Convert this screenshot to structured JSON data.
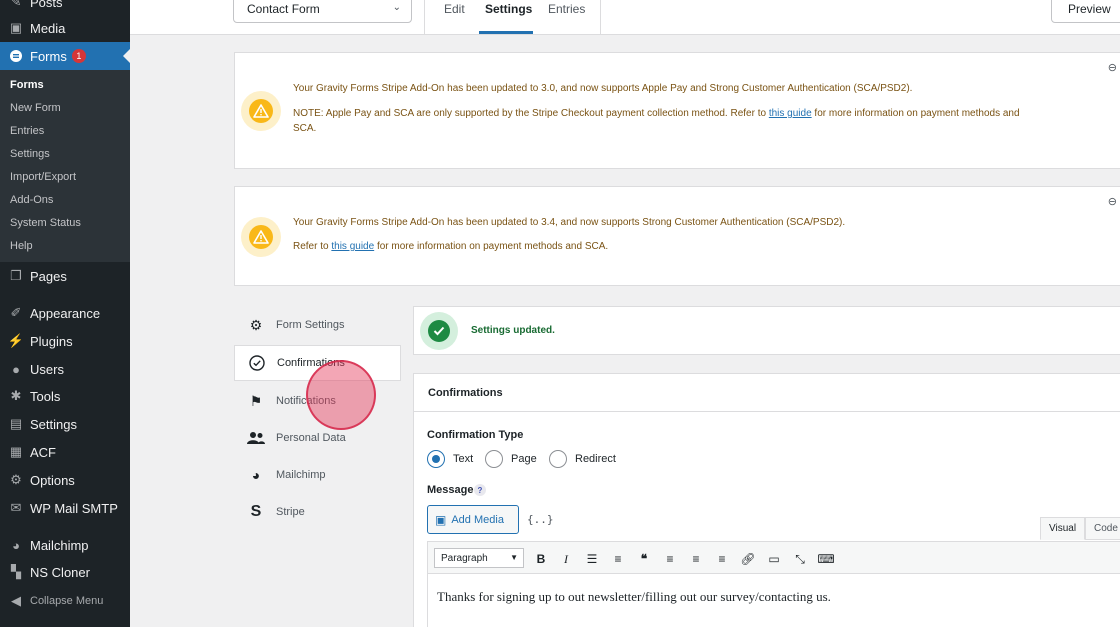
{
  "sidebar": {
    "items": [
      {
        "label": "Posts",
        "icon": "pin-icon"
      },
      {
        "label": "Media",
        "icon": "media-icon"
      },
      {
        "label": "Forms",
        "icon": "forms-icon",
        "badge": "1"
      },
      {
        "label": "Pages",
        "icon": "pages-icon"
      },
      {
        "label": "Appearance",
        "icon": "brush-icon"
      },
      {
        "label": "Plugins",
        "icon": "plugin-icon"
      },
      {
        "label": "Users",
        "icon": "users-icon"
      },
      {
        "label": "Tools",
        "icon": "wrench-icon"
      },
      {
        "label": "Settings",
        "icon": "settings-icon"
      },
      {
        "label": "ACF",
        "icon": "acf-icon"
      },
      {
        "label": "Options",
        "icon": "gear-icon"
      },
      {
        "label": "WP Mail SMTP",
        "icon": "mail-icon"
      },
      {
        "label": "Mailchimp",
        "icon": "mailchimp-icon"
      },
      {
        "label": "NS Cloner",
        "icon": "cloner-icon"
      }
    ],
    "submenu": [
      "Forms",
      "New Form",
      "Entries",
      "Settings",
      "Import/Export",
      "Add-Ons",
      "System Status",
      "Help"
    ],
    "collapse_label": "Collapse Menu"
  },
  "topbar": {
    "form_select": "Contact Form",
    "tabs": [
      "Edit",
      "Settings",
      "Entries"
    ],
    "preview_label": "Preview"
  },
  "notices": [
    {
      "line1": "Your Gravity Forms Stripe Add-On has been updated to 3.0, and now supports Apple Pay and Strong Customer Authentication (SCA/PSD2).",
      "line2_pre": "NOTE: Apple Pay and SCA are only supported by the Stripe Checkout payment collection method. Refer to ",
      "line2_link": "this guide",
      "line2_post": " for more information on payment methods and",
      "line3": "SCA."
    },
    {
      "line1": "Your Gravity Forms Stripe Add-On has been updated to 3.4, and now supports Strong Customer Authentication (SCA/PSD2).",
      "line2_pre": "Refer to ",
      "line2_link": "this guide",
      "line2_post": " for more information on payment methods and SCA."
    }
  ],
  "settings_nav": [
    {
      "label": "Form Settings",
      "icon": "gear-icon"
    },
    {
      "label": "Confirmations",
      "icon": "check-circle-icon"
    },
    {
      "label": "Notifications",
      "icon": "flag-icon"
    },
    {
      "label": "Personal Data",
      "icon": "people-icon"
    },
    {
      "label": "Mailchimp",
      "icon": "mailchimp-icon"
    },
    {
      "label": "Stripe",
      "icon": "stripe-icon"
    }
  ],
  "success_message": "Settings updated.",
  "panel": {
    "title": "Confirmations",
    "confirmation_type_label": "Confirmation Type",
    "options": [
      "Text",
      "Page",
      "Redirect"
    ],
    "selected_option": "Text",
    "message_label": "Message",
    "help_glyph": "?",
    "add_media_label": "Add Media",
    "merge_tag_glyph": "{..}",
    "editor_tabs": [
      "Visual",
      "Code"
    ],
    "format_select": "Paragraph",
    "message_text": "Thanks for signing up to out newsletter/filling out our survey/contacting us."
  },
  "colors": {
    "admin_bar": "#1d2327",
    "accent": "#2271b1",
    "warning": "#f9b818",
    "success": "#1e8a43",
    "badge": "#d63638",
    "click_indicator": "#e5395c"
  }
}
